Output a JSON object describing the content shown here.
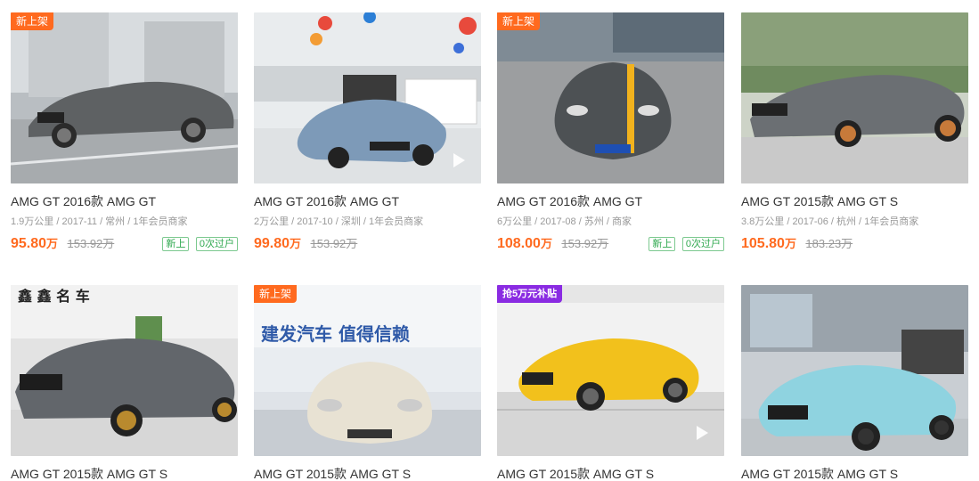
{
  "listings": [
    {
      "badge": "新上架",
      "title": "AMG GT 2016款 AMG GT",
      "meta": "1.9万公里 / 2017-11 / 常州 / 1年会员商家",
      "price": "95.80",
      "price_unit": "万",
      "original_price": "153.92万",
      "tags": [
        "新上",
        "0次过户"
      ],
      "has_video": false,
      "car_color": "#5e6163"
    },
    {
      "title": "AMG GT 2016款 AMG GT",
      "meta": "2万公里 / 2017-10 / 深圳 / 1年会员商家",
      "price": "99.80",
      "price_unit": "万",
      "original_price": "153.92万",
      "has_video": true,
      "car_color": "#7d9ab8"
    },
    {
      "badge": "新上架",
      "title": "AMG GT 2016款 AMG GT",
      "meta": "6万公里 / 2017-08 / 苏州 / 商家",
      "price": "108.00",
      "price_unit": "万",
      "original_price": "153.92万",
      "tags": [
        "新上",
        "0次过户"
      ],
      "has_video": false,
      "car_color": "#4d5154"
    },
    {
      "title": "AMG GT 2015款 AMG GT S",
      "meta": "3.8万公里 / 2017-06 / 杭州 / 1年会员商家",
      "price": "105.80",
      "price_unit": "万",
      "original_price": "183.23万",
      "has_video": false,
      "car_color": "#6b6f73"
    },
    {
      "title": "AMG GT 2015款 AMG GT S",
      "has_video": false,
      "car_color": "#62666b",
      "sign_text": "鑫 鑫 名 车"
    },
    {
      "badge": "新上架",
      "title": "AMG GT 2015款 AMG GT S",
      "has_video": false,
      "car_color": "#e8e2d3",
      "sign_text": "建发汽车  值得信赖"
    },
    {
      "badge": "抢5万元补贴",
      "badge_style": "purple",
      "title": "AMG GT 2015款 AMG GT S",
      "has_video": true,
      "car_color": "#f2c11c"
    },
    {
      "title": "AMG GT 2015款 AMG GT S",
      "has_video": false,
      "car_color": "#8fd3e0"
    }
  ]
}
